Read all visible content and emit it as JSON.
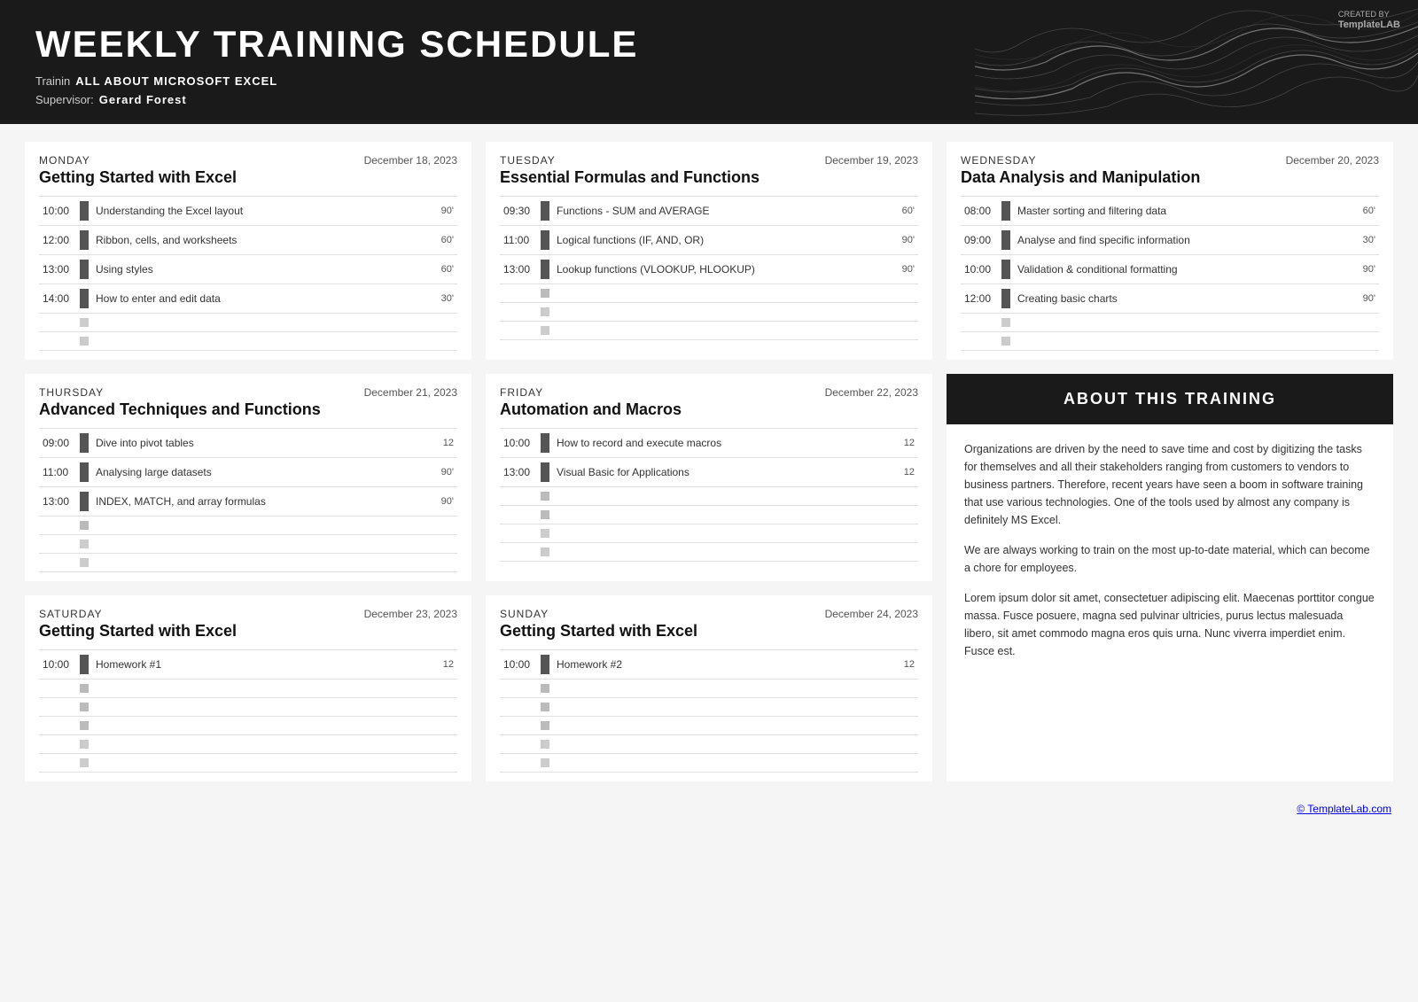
{
  "header": {
    "title": "WEEKLY TRAINING SCHEDULE",
    "training_label": "Trainin",
    "training_value": "ALL ABOUT MICROSOFT EXCEL",
    "supervisor_label": "Supervisor:",
    "supervisor_value": "Gerard Forest",
    "templatelab": "TemplateLAB"
  },
  "days": [
    {
      "id": "monday",
      "name": "MONDAY",
      "date": "December 18, 2023",
      "title": "Getting Started with Excel",
      "sessions": [
        {
          "time": "10:00",
          "desc": "Understanding the Excel layout",
          "duration": "90'"
        },
        {
          "time": "12:00",
          "desc": "Ribbon, cells, and worksheets",
          "duration": "60'"
        },
        {
          "time": "13:00",
          "desc": "Using styles",
          "duration": "60'"
        },
        {
          "time": "14:00",
          "desc": "How to enter and edit data",
          "duration": "30'"
        }
      ]
    },
    {
      "id": "tuesday",
      "name": "TUESDAY",
      "date": "December 19, 2023",
      "title": "Essential Formulas and Functions",
      "sessions": [
        {
          "time": "09:30",
          "desc": "Functions - SUM and AVERAGE",
          "duration": "60'"
        },
        {
          "time": "11:00",
          "desc": "Logical functions (IF, AND, OR)",
          "duration": "90'"
        },
        {
          "time": "13:00",
          "desc": "Lookup functions (VLOOKUP, HLOOKUP)",
          "duration": "90'"
        },
        {
          "time": "",
          "desc": "",
          "duration": ""
        }
      ]
    },
    {
      "id": "wednesday",
      "name": "WEDNESDAY",
      "date": "December 20, 2023",
      "title": "Data Analysis and Manipulation",
      "sessions": [
        {
          "time": "08:00",
          "desc": "Master sorting and filtering data",
          "duration": "60'"
        },
        {
          "time": "09:00",
          "desc": "Analyse and find specific information",
          "duration": "30'"
        },
        {
          "time": "10:00",
          "desc": "Validation & conditional formatting",
          "duration": "90'"
        },
        {
          "time": "12:00",
          "desc": "Creating basic charts",
          "duration": "90'"
        }
      ]
    },
    {
      "id": "thursday",
      "name": "THURSDAY",
      "date": "December 21, 2023",
      "title": "Advanced Techniques and Functions",
      "sessions": [
        {
          "time": "09:00",
          "desc": "Dive into pivot tables",
          "duration": "12"
        },
        {
          "time": "11:00",
          "desc": "Analysing large datasets",
          "duration": "90'"
        },
        {
          "time": "13:00",
          "desc": "INDEX, MATCH, and array formulas",
          "duration": "90'"
        },
        {
          "time": "",
          "desc": "",
          "duration": ""
        }
      ]
    },
    {
      "id": "friday",
      "name": "FRIDAY",
      "date": "December 22, 2023",
      "title": "Automation and Macros",
      "sessions": [
        {
          "time": "10:00",
          "desc": "How to record and execute macros",
          "duration": "12"
        },
        {
          "time": "13:00",
          "desc": "Visual Basic for Applications",
          "duration": "12"
        },
        {
          "time": "",
          "desc": "",
          "duration": ""
        },
        {
          "time": "",
          "desc": "",
          "duration": ""
        }
      ]
    },
    {
      "id": "saturday",
      "name": "SATURDAY",
      "date": "December 23, 2023",
      "title": "Getting Started with Excel",
      "sessions": [
        {
          "time": "10:00",
          "desc": "Homework #1",
          "duration": "12"
        },
        {
          "time": "",
          "desc": "",
          "duration": ""
        },
        {
          "time": "",
          "desc": "",
          "duration": ""
        },
        {
          "time": "",
          "desc": "",
          "duration": ""
        }
      ]
    },
    {
      "id": "sunday",
      "name": "SUNDAY",
      "date": "December 24, 2023",
      "title": "Getting Started with Excel",
      "sessions": [
        {
          "time": "10:00",
          "desc": "Homework #2",
          "duration": "12"
        },
        {
          "time": "",
          "desc": "",
          "duration": ""
        },
        {
          "time": "",
          "desc": "",
          "duration": ""
        },
        {
          "time": "",
          "desc": "",
          "duration": ""
        }
      ]
    }
  ],
  "about": {
    "header": "ABOUT THIS TRAINING",
    "paragraphs": [
      "Organizations are driven by the need to save time and cost by digitizing the tasks for themselves and all their stakeholders ranging from customers to vendors to business partners. Therefore, recent years have seen a boom in software training that use various technologies. One of the tools used by almost any company is definitely MS Excel.",
      "We are always working to train on the most up-to-date material, which can become a chore for employees.",
      "Lorem ipsum dolor sit amet, consectetuer adipiscing elit. Maecenas porttitor congue massa. Fusce posuere, magna sed pulvinar ultricies, purus lectus malesuada libero, sit amet commodo magna eros quis urna. Nunc viverra imperdiet enim. Fusce est."
    ]
  },
  "footer": {
    "link": "© TemplateLab.com"
  }
}
